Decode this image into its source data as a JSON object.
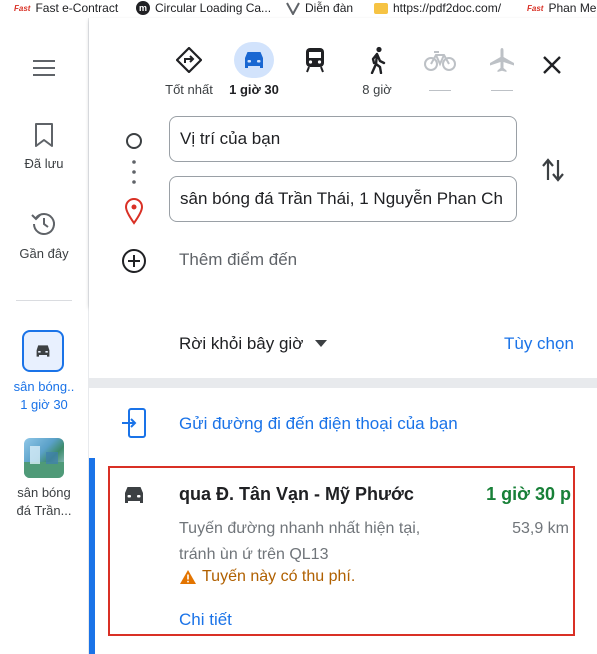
{
  "bookmarks": [
    {
      "icon": "fast-logo-icon",
      "label": "Fast e-Contract"
    },
    {
      "icon": "m-circle-icon",
      "label": "Circular Loading Ca..."
    },
    {
      "icon": "v-logo-icon",
      "label": "Diễn đàn"
    },
    {
      "icon": "folder-icon",
      "label": "https://pdf2doc.com/"
    },
    {
      "icon": "fast-logo-icon",
      "label": "Phan Me"
    }
  ],
  "bookmark_badge": "Fast",
  "sidebar": {
    "saved_label": "Đã lưu",
    "recent_label": "Gần đây",
    "recent_items": [
      {
        "line1": "sân bóng..",
        "line2": "1 giờ 30"
      },
      {
        "line1": "sân bóng",
        "line2": "đá Trần..."
      }
    ]
  },
  "modes": [
    {
      "name": "best",
      "label": "Tốt nhất",
      "selected": false
    },
    {
      "name": "driving",
      "label": "1 giờ 30",
      "selected": true
    },
    {
      "name": "transit",
      "label": "",
      "selected": false
    },
    {
      "name": "walking",
      "label": "8 giờ",
      "selected": false
    },
    {
      "name": "cycling",
      "label": "—",
      "selected": false
    },
    {
      "name": "flights",
      "label": "—",
      "selected": false
    }
  ],
  "origin": {
    "value": "Vị trí của bạn"
  },
  "destination": {
    "value": "sân bóng đá Trần Thái, 1 Nguyễn Phan Ch"
  },
  "add_destination": "Thêm điểm đến",
  "depart": {
    "label": "Rời khỏi bây giờ",
    "options": "Tùy chọn"
  },
  "send_to_phone": "Gửi đường đi đến điện thoại của bạn",
  "route": {
    "title": "qua Đ. Tân Vạn - Mỹ Phước",
    "duration": "1 giờ 30 p",
    "description": "Tuyến đường nhanh nhất hiện tại, tránh ùn ứ trên QL13",
    "distance": "53,9 km",
    "toll_warning": "Tuyến này có thu phí.",
    "details_link": "Chi tiết"
  },
  "colors": {
    "accent": "#1a73e8",
    "duration_green": "#188038",
    "warning": "#b06000",
    "highlight_box": "#d93025"
  }
}
